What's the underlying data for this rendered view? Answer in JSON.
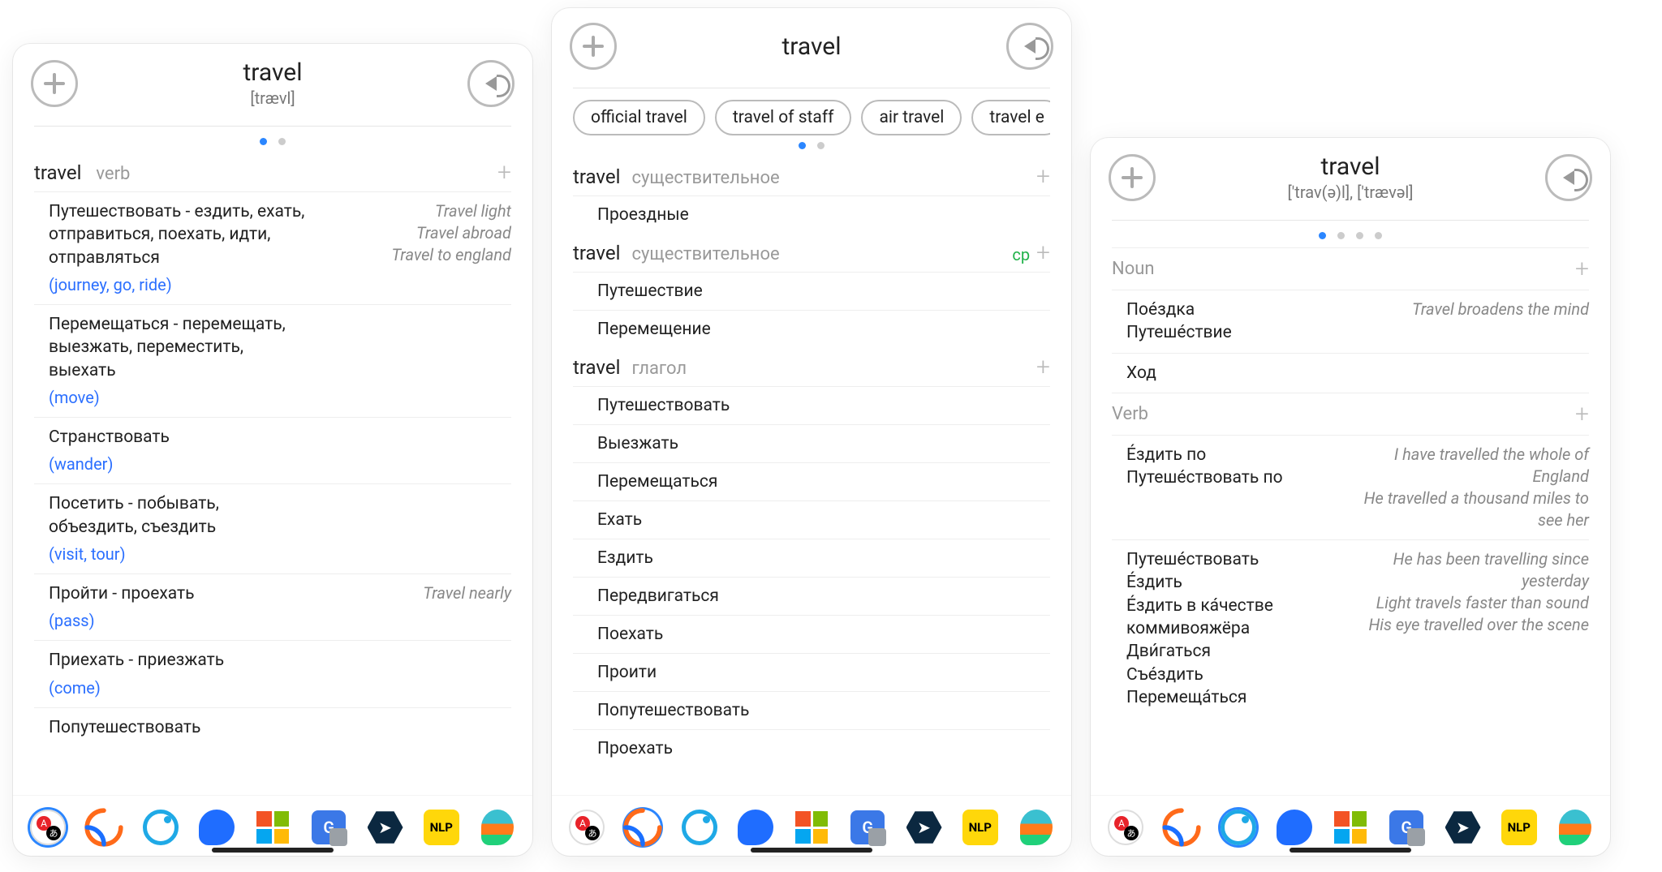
{
  "card1": {
    "title": "travel",
    "phonetic": "[trævl]",
    "pager_count": 2,
    "pager_active": 0,
    "pos_header": {
      "word": "travel",
      "pos": "verb"
    },
    "senses": [
      {
        "trans": "Путешествовать - ездить, ехать, отправиться, поехать, идти, отправляться",
        "syn": "(journey, go, ride)",
        "examples": "Travel light\nTravel abroad\nTravel to england"
      },
      {
        "trans": "Перемещаться - перемещать, выезжать, переместить, выехать",
        "syn": "(move)",
        "examples": ""
      },
      {
        "trans": "Странствовать",
        "syn": "(wander)",
        "examples": ""
      },
      {
        "trans": "Посетить - побывать, объездить, съездить",
        "syn": "(visit, tour)",
        "examples": ""
      },
      {
        "trans": "Пройти - проехать",
        "syn": "(pass)",
        "examples": "Travel nearly"
      },
      {
        "trans": "Приехать - приезжать",
        "syn": "(come)",
        "examples": ""
      },
      {
        "trans": "Попутешествовать",
        "syn": "",
        "examples": ""
      }
    ]
  },
  "card2": {
    "title": "travel",
    "chips": [
      "official travel",
      "travel of staff",
      "air travel",
      "travel e"
    ],
    "pager_count": 2,
    "pager_active": 0,
    "groups": [
      {
        "word": "travel",
        "pos": "существительное",
        "tag": "",
        "items": [
          "Проездные"
        ]
      },
      {
        "word": "travel",
        "pos": "существительное",
        "tag": "ср",
        "items": [
          "Путешествие",
          "Перемещение"
        ]
      },
      {
        "word": "travel",
        "pos": "глагол",
        "tag": "",
        "items": [
          "Путешествовать",
          "Выезжать",
          "Перемещаться",
          "Ехать",
          "Ездить",
          "Передвигаться",
          "Поехать",
          "Проити",
          "Попутешествовать",
          "Проехать"
        ]
      }
    ]
  },
  "card3": {
    "title": "travel",
    "phonetic": "['trav(ə)l], ['trævəl]",
    "pager_count": 4,
    "pager_active": 0,
    "groups": [
      {
        "head": "Noun",
        "blocks": [
          {
            "trans": "Пое́здка\nПутеше́ствие",
            "examples": "Travel broadens the mind"
          },
          {
            "trans": "Ход",
            "examples": ""
          }
        ]
      },
      {
        "head": "Verb",
        "blocks": [
          {
            "trans": "Е́здить по\nПутеше́ствовать по",
            "examples": "I have travelled the whole of England\nHe travelled a thousand miles to see her"
          },
          {
            "trans": "Путеше́ствовать\nЕ́здить\nЕ́здить в ка́честве коммивояжёра\nДви́гаться\nСъе́здить\nПеремеща́ться",
            "examples": "He has been travelling since yesterday\nLight travels faster than sound\nHis eye travelled over the scene"
          }
        ]
      }
    ]
  },
  "dock": {
    "icons": [
      "translator",
      "swirl",
      "disk",
      "assistant",
      "microsoft",
      "google-translate",
      "deepl",
      "nlp",
      "parrot"
    ]
  }
}
